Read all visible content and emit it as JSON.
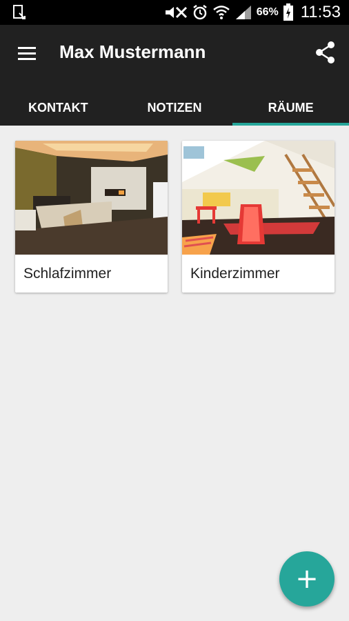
{
  "status_bar": {
    "battery_percent": "66%",
    "time": "11:53",
    "icons": [
      "notification-icon",
      "mute-icon",
      "alarm-icon",
      "wifi-icon",
      "signal-icon",
      "battery-icon"
    ]
  },
  "app_bar": {
    "title": "Max Mustermann",
    "menu_icon": "hamburger-menu-icon",
    "share_icon": "share-icon"
  },
  "tabs": [
    {
      "label": "KONTAKT",
      "active": false
    },
    {
      "label": "NOTIZEN",
      "active": false
    },
    {
      "label": "RÄUME",
      "active": true
    }
  ],
  "rooms": [
    {
      "name": "Schlafzimmer",
      "image": "bedroom-photo"
    },
    {
      "name": "Kinderzimmer",
      "image": "kids-room-photo"
    }
  ],
  "fab": {
    "symbol": "+"
  },
  "colors": {
    "app_bar": "#212121",
    "accent": "#26a69a",
    "background": "#eeeeee"
  }
}
